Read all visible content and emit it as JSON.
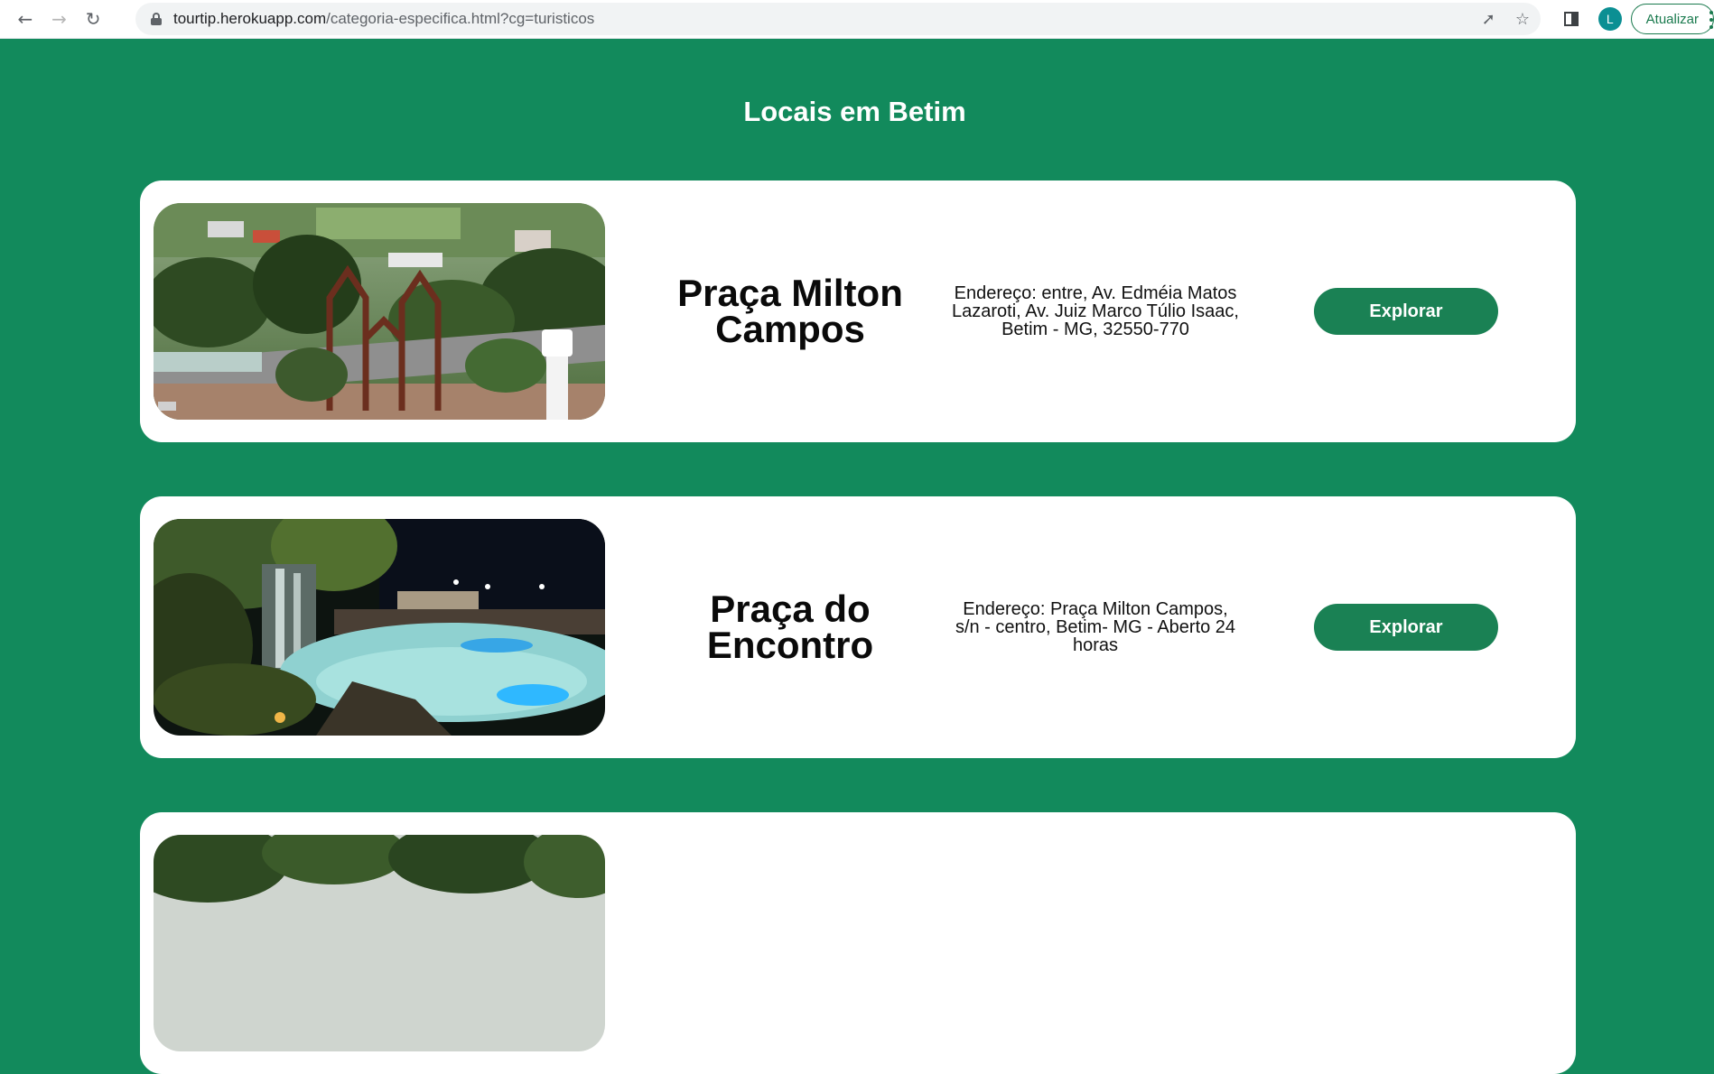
{
  "browser": {
    "url_domain": "tourtip.herokuapp.com",
    "url_path": "/categoria-especifica.html?cg=turisticos",
    "avatar_initial": "L",
    "update_label": "Atualizar"
  },
  "page": {
    "title": "Locais em Betim"
  },
  "places": [
    {
      "name": "Praça Milton Campos",
      "address": "Endereço: entre, Av. Edméia Matos Lazaroti, Av. Juiz Marco Túlio Isaac, Betim - MG, 32550-770",
      "button_label": "Explorar"
    },
    {
      "name": "Praça do Encontro",
      "address": "Endereço: Praça Milton Campos, s/n - centro, Betim- MG - Aberto 24 horas",
      "button_label": "Explorar"
    }
  ],
  "colors": {
    "background": "#128a5c",
    "button": "#1a8154",
    "card": "#ffffff"
  },
  "icons": [
    "back-arrow-icon",
    "forward-arrow-icon",
    "reload-icon",
    "lock-icon",
    "share-icon",
    "star-icon",
    "side-panel-icon",
    "kebab-menu-icon"
  ]
}
